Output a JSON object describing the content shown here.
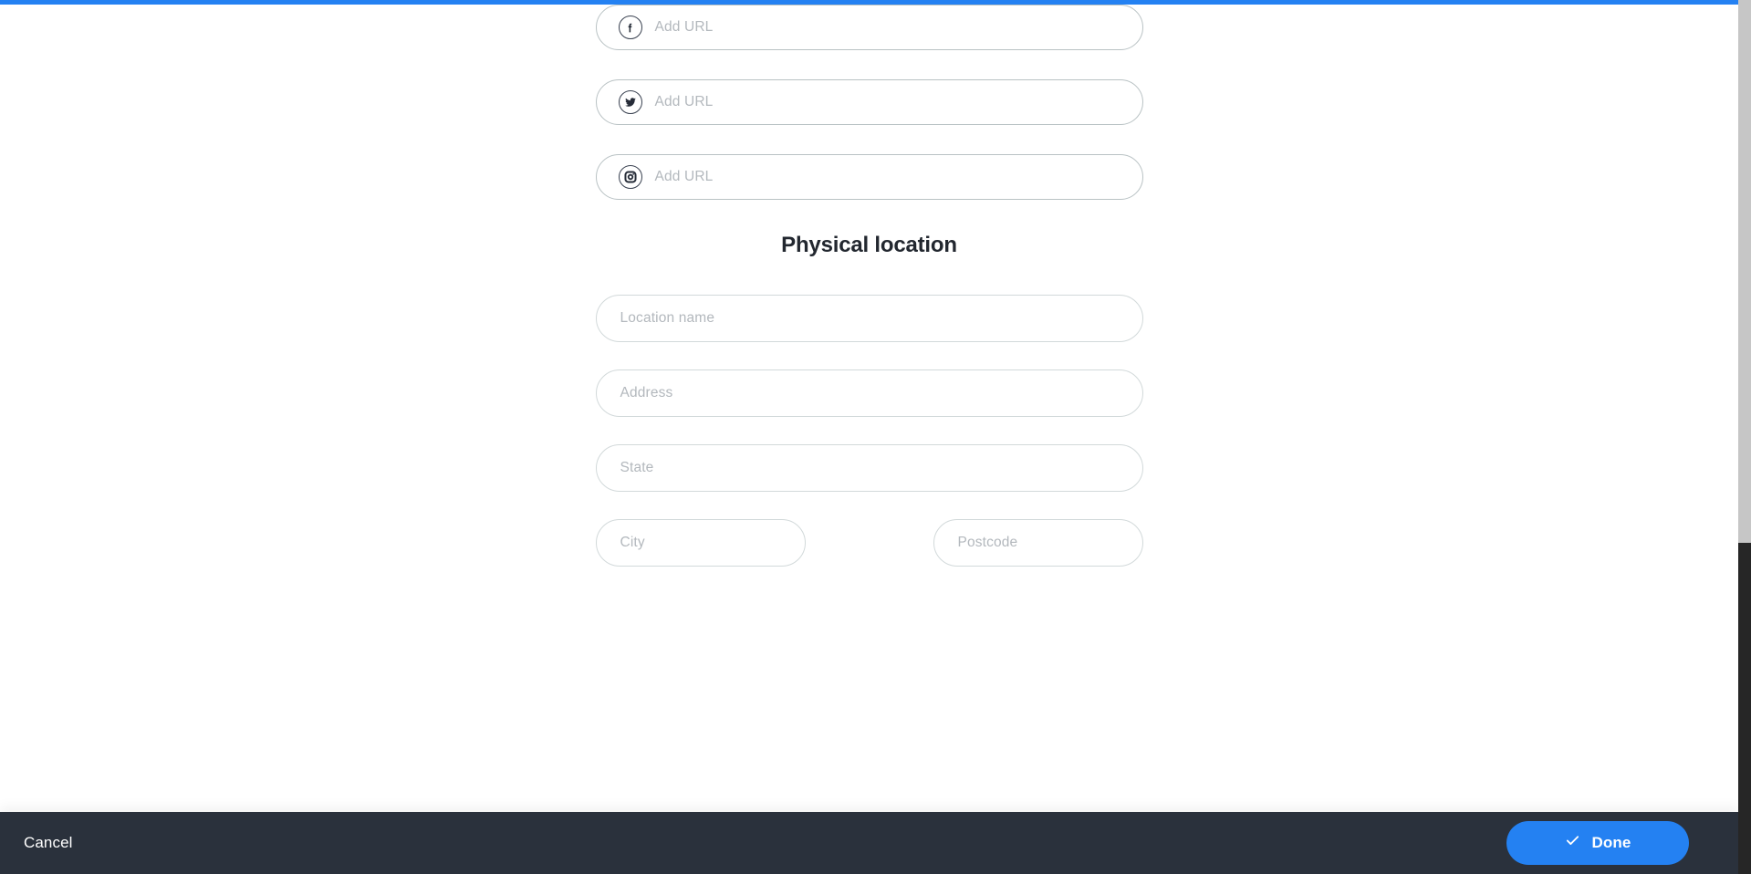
{
  "theme": {
    "accent_color": "#2481f2",
    "bottom_bar_color": "#2a313c",
    "placeholder_color": "#b3b8bd",
    "heading_color": "#22272f",
    "field_border_color": "#d2d9da"
  },
  "social_links": {
    "fields": [
      {
        "icon": "facebook-icon",
        "placeholder": "Add URL",
        "value": ""
      },
      {
        "icon": "twitter-icon",
        "placeholder": "Add URL",
        "value": ""
      },
      {
        "icon": "instagram-icon",
        "placeholder": "Add URL",
        "value": ""
      }
    ]
  },
  "physical_location": {
    "heading": "Physical location",
    "location_name": {
      "placeholder": "Location name",
      "value": ""
    },
    "address": {
      "placeholder": "Address",
      "value": ""
    },
    "state": {
      "placeholder": "State",
      "value": ""
    },
    "city": {
      "placeholder": "City",
      "value": ""
    },
    "postcode": {
      "placeholder": "Postcode",
      "value": ""
    }
  },
  "bottom_bar": {
    "cancel_label": "Cancel",
    "done_label": "Done",
    "done_icon": "check-icon"
  }
}
